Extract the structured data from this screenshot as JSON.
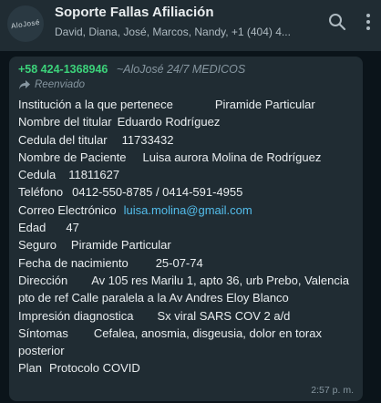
{
  "header": {
    "avatar_text": "AloJosé",
    "title": "Soporte Fallas Afiliación",
    "subtitle": "David, Diana, José, Marcos, Nandy, +1 (404) 4..."
  },
  "message": {
    "sender_phone": "+58 424-1368946",
    "sender_name": "~AloJosé 24/7 MEDICOS",
    "forwarded_label": "Reenviado",
    "rows": [
      {
        "label": "Institución a la que pertenece",
        "value": "Piramide Particular"
      },
      {
        "label": "Nombre del titular",
        "value": "Eduardo Rodríguez"
      },
      {
        "label": "Cedula del titular",
        "value": "11733432"
      },
      {
        "label": "Nombre de Paciente",
        "value": "Luisa aurora Molina de Rodríguez"
      },
      {
        "label": "Cedula",
        "value": "11811627"
      },
      {
        "label": "Teléfono",
        "value": "0412-550-8785 / 0414-591-4955"
      },
      {
        "label": "Correo Electrónico",
        "value": "luisa.molina@gmail.com"
      },
      {
        "label": "Edad",
        "value": "47"
      },
      {
        "label": "Seguro",
        "value": "Piramide Particular"
      },
      {
        "label": "Fecha de nacimiento",
        "value": "25-07-74"
      },
      {
        "label": "Dirección",
        "value": "Av 105 res Marilu 1, apto 36, urb Prebo, Valencia pto de ref Calle paralela a la Av Andres Eloy Blanco"
      },
      {
        "label": "Impresión diagnostica",
        "value": "Sx viral SARS COV 2 a/d"
      },
      {
        "label": "Síntomas",
        "value": "Cefalea, anosmia, disgeusia, dolor en torax posterior"
      },
      {
        "label": "Plan",
        "value": "Protocolo COVID"
      }
    ],
    "time": "2:57 p. m."
  }
}
